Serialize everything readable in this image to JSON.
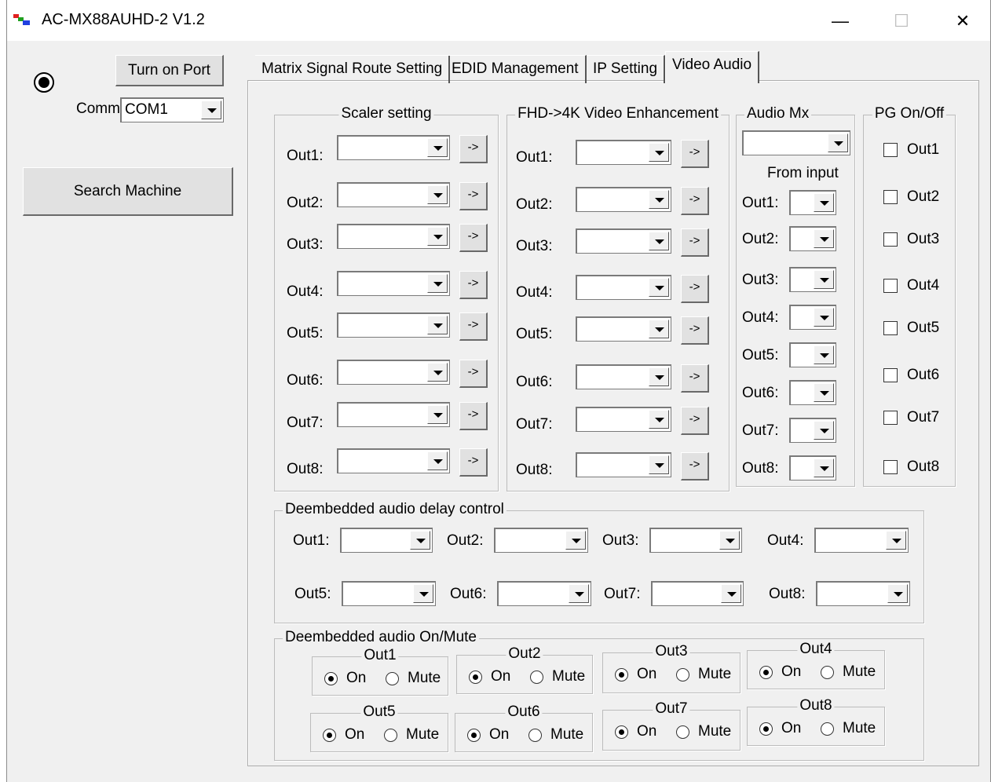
{
  "window": {
    "title": "AC-MX88AUHD-2 V1.2",
    "min_glyph": "—",
    "max_glyph": "☐",
    "close_glyph": "✕"
  },
  "left": {
    "turn_on_port": "Turn on Port",
    "comm_label": "Comm:",
    "comm_value": "COM1",
    "search_machine": "Search Machine"
  },
  "tabs": [
    "Matrix Signal Route Setting",
    "EDID Management",
    "IP Setting",
    "Video  Audio"
  ],
  "active_tab": "Video  Audio",
  "scaler": {
    "title": "Scaler setting",
    "outputs": [
      "Out1:",
      "Out2:",
      "Out3:",
      "Out4:",
      "Out5:",
      "Out6:",
      "Out7:",
      "Out8:"
    ],
    "apply_label": "->"
  },
  "fhd": {
    "title": "FHD->4K Video Enhancement",
    "outputs": [
      "Out1:",
      "Out2:",
      "Out3:",
      "Out4:",
      "Out5:",
      "Out6:",
      "Out7:",
      "Out8:"
    ],
    "apply_label": "->"
  },
  "audio_mx": {
    "title": "Audio Mx",
    "from_input": "From input",
    "outputs": [
      "Out1:",
      "Out2:",
      "Out3:",
      "Out4:",
      "Out5:",
      "Out6:",
      "Out7:",
      "Out8:"
    ]
  },
  "pg": {
    "title": "PG On/Off",
    "outputs": [
      "Out1",
      "Out2",
      "Out3",
      "Out4",
      "Out5",
      "Out6",
      "Out7",
      "Out8"
    ]
  },
  "delay": {
    "title": "Deembedded audio delay control",
    "outputs": [
      "Out1:",
      "Out2:",
      "Out3:",
      "Out4:",
      "Out5:",
      "Out6:",
      "Out7:",
      "Out8:"
    ]
  },
  "mute": {
    "title": "Deembedded audio On/Mute",
    "outputs": [
      "Out1",
      "Out2",
      "Out3",
      "Out4",
      "Out5",
      "Out6",
      "Out7",
      "Out8"
    ],
    "on_label": "On",
    "mute_label": "Mute",
    "selected": [
      "On",
      "On",
      "On",
      "On",
      "On",
      "On",
      "On",
      "On"
    ]
  }
}
